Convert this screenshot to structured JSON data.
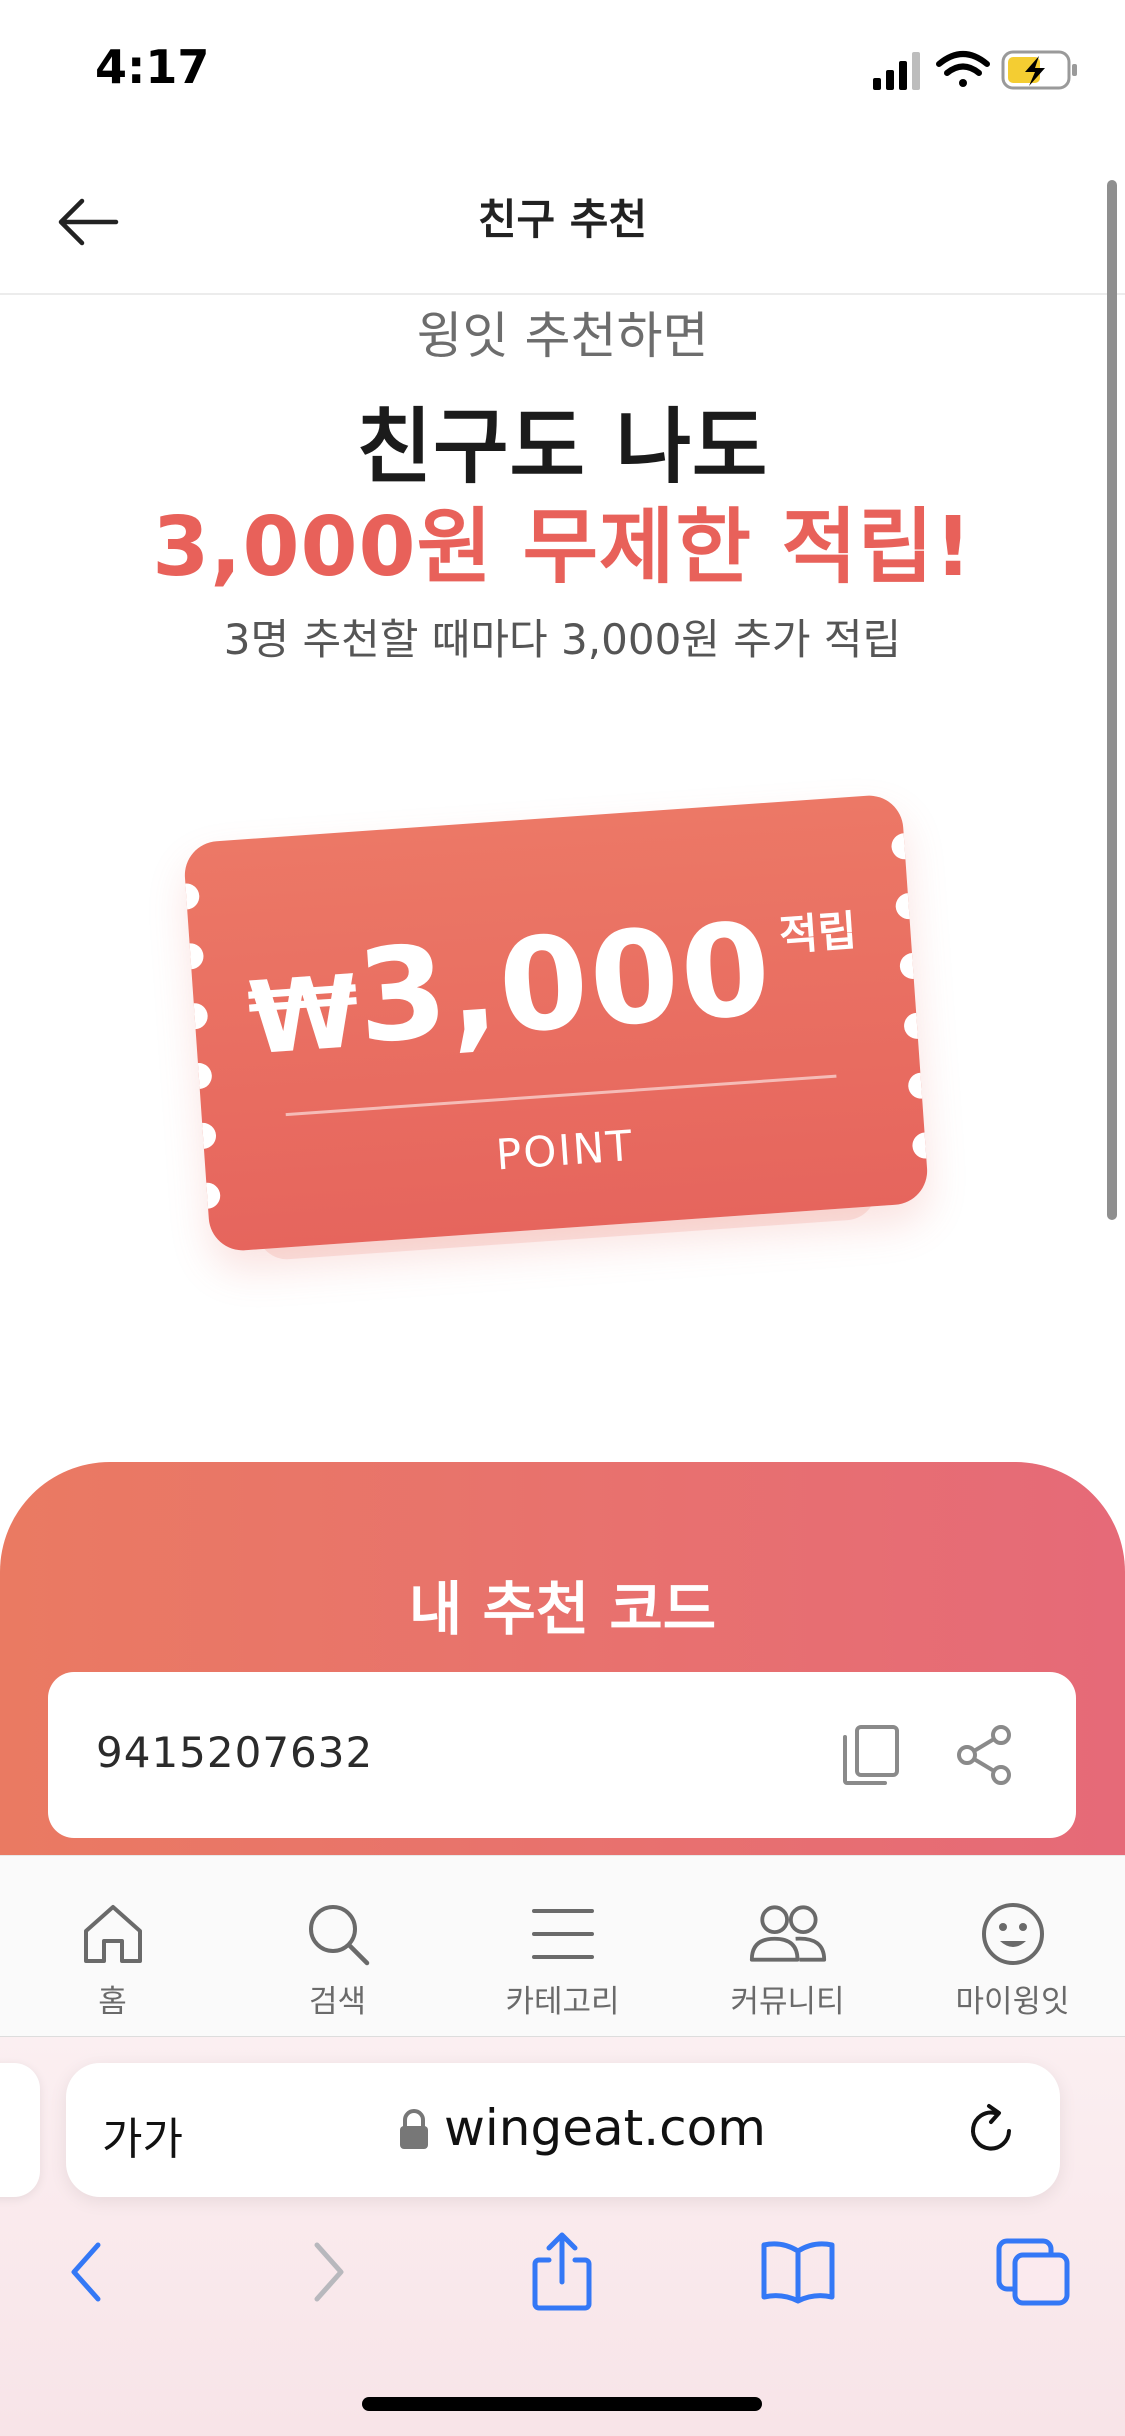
{
  "status_bar": {
    "time": "4:17"
  },
  "header": {
    "title": "친구 추천"
  },
  "hero": {
    "subtitle": "윙잇 추천하면",
    "title": "친구도 나도",
    "highlight": "3,000원 무제한 적립!",
    "description": "3명 추천할 때마다 3,000원 추가 적립"
  },
  "ticket": {
    "currency": "₩",
    "amount": "3,000",
    "tag": "적립",
    "label": "POINT"
  },
  "referral": {
    "title": "내 추천 코드",
    "code": "9415207632"
  },
  "tabbar": {
    "items": [
      {
        "label": "홈",
        "icon": "home-icon"
      },
      {
        "label": "검색",
        "icon": "search-icon"
      },
      {
        "label": "카테고리",
        "icon": "menu-icon"
      },
      {
        "label": "커뮤니티",
        "icon": "people-icon"
      },
      {
        "label": "마이윙잇",
        "icon": "smile-icon"
      }
    ]
  },
  "browser": {
    "text_size_button": "가가",
    "url": "wingeat.com"
  },
  "colors": {
    "accent": "#e8615a",
    "ticket": "#e96c60",
    "safari_blue": "#3478f6"
  }
}
